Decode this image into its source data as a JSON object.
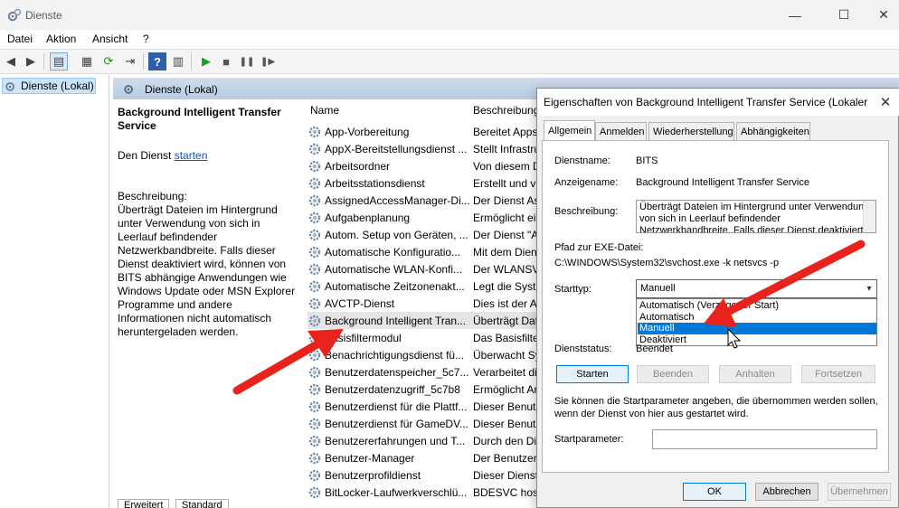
{
  "window": {
    "title": "Dienste",
    "minimize_glyph": "—",
    "maximize_glyph": "☐",
    "close_glyph": "✕",
    "icon": "gears-icon"
  },
  "menu": [
    "Datei",
    "Aktion",
    "Ansicht",
    "?"
  ],
  "toolbar": {
    "icons": [
      "back-arrow-icon",
      "forward-arrow-icon",
      "console-tree-icon",
      "properties-icon",
      "refresh-icon",
      "export-list-icon",
      "help-icon",
      "action-pane-icon",
      "play-icon",
      "stop-icon",
      "pause-icon",
      "restart-icon"
    ],
    "glyphs": [
      "◀",
      "▶",
      "▤",
      "▦",
      "⟳",
      "⇥",
      "?",
      "▥",
      "▶",
      "■",
      "❚❚",
      "❚▶"
    ]
  },
  "tree": {
    "root_label": "Dienste (Lokal)"
  },
  "main": {
    "header_label": "Dienste (Lokal)",
    "selected_title": "Background Intelligent Transfer Service",
    "start_prefix": "Den Dienst ",
    "start_link": "starten",
    "description_label": "Beschreibung:",
    "description_text": "Überträgt Dateien im Hintergrund unter Verwendung von sich in Leerlauf befindender Netzwerkbandbreite. Falls dieser Dienst deaktiviert wird, können von BITS abhängige Anwendungen wie Windows Update oder MSN Explorer Programme und andere Informationen nicht automatisch heruntergeladen werden.",
    "columns": {
      "name": "Name",
      "description": "Beschreibung"
    },
    "rows": [
      {
        "name": "App-Vorbereitung",
        "desc": "Bereitet Apps"
      },
      {
        "name": "AppX-Bereitstellungsdienst ...",
        "desc": "Stellt Infrastru"
      },
      {
        "name": "Arbeitsordner",
        "desc": "Von diesem D"
      },
      {
        "name": "Arbeitsstationsdienst",
        "desc": "Erstellt und v"
      },
      {
        "name": "AssignedAccessManager-Di...",
        "desc": "Der Dienst As"
      },
      {
        "name": "Aufgabenplanung",
        "desc": "Ermöglicht ei"
      },
      {
        "name": "Autom. Setup von Geräten, ...",
        "desc": "Der Dienst \"A"
      },
      {
        "name": "Automatische Konfiguratio...",
        "desc": "Mit dem Diens"
      },
      {
        "name": "Automatische WLAN-Konfi...",
        "desc": "Der WLANSV"
      },
      {
        "name": "Automatische Zeitzonenakt...",
        "desc": "Legt die Syste"
      },
      {
        "name": "AVCTP-Dienst",
        "desc": "Dies ist der A"
      },
      {
        "name": "Background Intelligent Tran...",
        "desc": "Überträgt Dat"
      },
      {
        "name": "Basisfiltermodul",
        "desc": "Das Basisfilte"
      },
      {
        "name": "Benachrichtigungsdienst fü...",
        "desc": "Überwacht Sy"
      },
      {
        "name": "Benutzerdatenspeicher_5c7...",
        "desc": "Verarbeitet di"
      },
      {
        "name": "Benutzerdatenzugriff_5c7b8",
        "desc": "Ermöglicht Ar"
      },
      {
        "name": "Benutzerdienst für die Plattf...",
        "desc": "Dieser Benutz"
      },
      {
        "name": "Benutzerdienst für GameDV...",
        "desc": "Dieser Benutz"
      },
      {
        "name": "Benutzererfahrungen und T...",
        "desc": "Durch den Die"
      },
      {
        "name": "Benutzer-Manager",
        "desc": "Der Benutzer"
      },
      {
        "name": "Benutzerprofildienst",
        "desc": "Dieser Dienst"
      },
      {
        "name": "BitLocker-Laufwerkverschlü...",
        "desc": "BDESVC host"
      }
    ],
    "bottom_tabs": [
      "Erweitert",
      "Standard"
    ]
  },
  "dialog": {
    "title": "Eigenschaften von Background Intelligent Transfer Service (Lokaler Computer)",
    "close_glyph": "✕",
    "tabs": [
      "Allgemein",
      "Anmelden",
      "Wiederherstellung",
      "Abhängigkeiten"
    ],
    "service_name_label": "Dienstname:",
    "service_name": "BITS",
    "display_name_label": "Anzeigename:",
    "display_name": "Background Intelligent Transfer Service",
    "description_label": "Beschreibung:",
    "description": "Überträgt Dateien im Hintergrund unter Verwendung von sich in Leerlauf befindender Netzwerkbandbreite. Falls dieser Dienst deaktiviert",
    "exe_path_label": "Pfad zur EXE-Datei:",
    "exe_path": "C:\\WINDOWS\\System32\\svchost.exe -k netsvcs -p",
    "startup_type_label": "Starttyp:",
    "startup_type_value": "Manuell",
    "startup_options": [
      "Automatisch (Verzögerter Start)",
      "Automatisch",
      "Manuell",
      "Deaktiviert"
    ],
    "highlighted_option": "Manuell",
    "status_label": "Dienststatus:",
    "status_value": "Beendet",
    "buttons": {
      "start": "Starten",
      "stop": "Beenden",
      "pause": "Anhalten",
      "resume": "Fortsetzen"
    },
    "hint": "Sie können die Startparameter angeben, die übernommen werden sollen, wenn der Dienst von hier aus gestartet wird.",
    "param_label": "Startparameter:",
    "param_value": "",
    "ok": "OK",
    "cancel": "Abbrechen",
    "apply": "Übernehmen"
  },
  "annotation_color": "#e8231b"
}
